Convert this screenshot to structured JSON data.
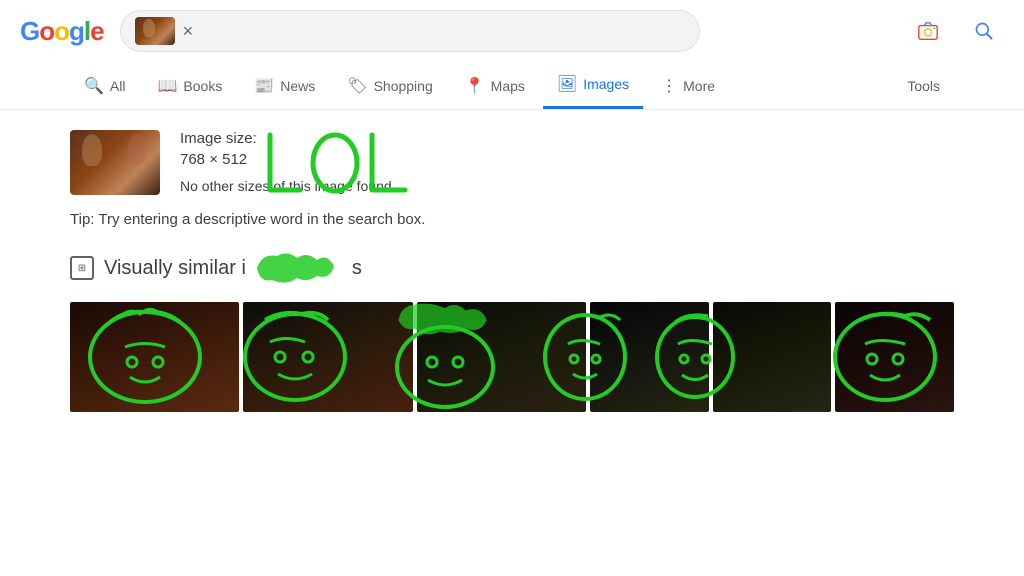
{
  "header": {
    "logo": "Google",
    "search_close": "×"
  },
  "nav": {
    "items": [
      {
        "label": "All",
        "icon": "🔍",
        "active": false
      },
      {
        "label": "Books",
        "icon": "📖",
        "active": false
      },
      {
        "label": "News",
        "icon": "📰",
        "active": false
      },
      {
        "label": "Shopping",
        "icon": "🏷",
        "active": false
      },
      {
        "label": "Maps",
        "icon": "📍",
        "active": false
      },
      {
        "label": "Images",
        "icon": "🖼",
        "active": true
      },
      {
        "label": "More",
        "icon": "⋮",
        "active": false
      }
    ],
    "tools": "Tools"
  },
  "result": {
    "image_size_label": "Image size:",
    "dimensions": "768 × 512",
    "no_other_sizes": "No other sizes of this image found."
  },
  "tip": {
    "text": "Tip: Try entering a descriptive word in the search box."
  },
  "similar": {
    "header": "Visually similar images"
  },
  "annotation": {
    "lol_text": "LOL"
  },
  "colors": {
    "google_blue": "#4285F4",
    "google_red": "#EA4335",
    "google_yellow": "#FBBC05",
    "google_green": "#34A853",
    "active_blue": "#1a73e8",
    "green_draw": "#22CC22"
  }
}
